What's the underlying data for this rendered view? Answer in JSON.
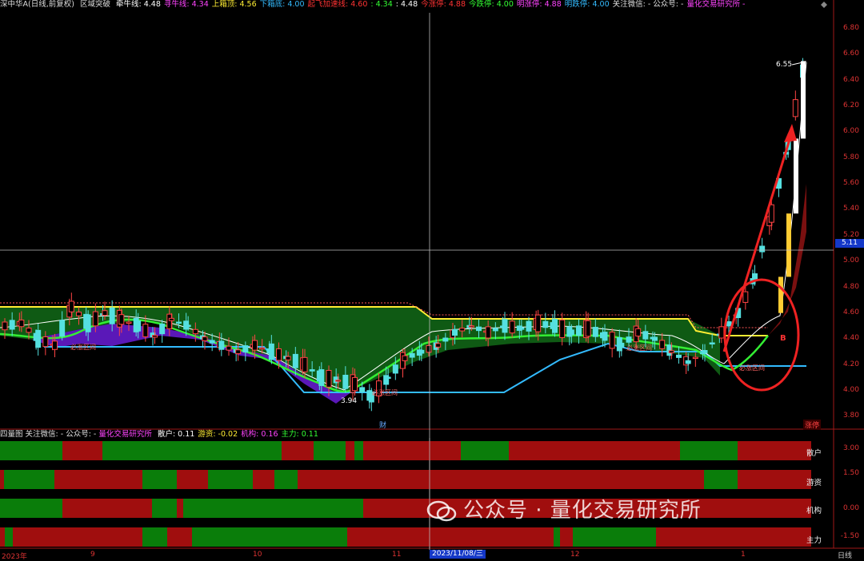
{
  "header": {
    "stock": "深中华A(日线,前复权)",
    "indicator": "区域突破",
    "items": [
      {
        "label": "牵牛线: 4.48",
        "color": "#ffffff"
      },
      {
        "label": "寻牛线: 4.34",
        "color": "#ff44ff"
      },
      {
        "label": "上箱顶: 4.56",
        "color": "#ffee33"
      },
      {
        "label": "下箱底: 4.00",
        "color": "#33bbff"
      },
      {
        "label": "起飞加速线: 4.60",
        "color": "#ff3333"
      },
      {
        "label": ": 4.34",
        "color": "#33ff33"
      },
      {
        "label": ": 4.48",
        "color": "#ffffff"
      },
      {
        "label": "今涨停: 4.88",
        "color": "#ff3333"
      },
      {
        "label": "今跌停: 4.00",
        "color": "#33ff33"
      },
      {
        "label": "明涨停: 4.88",
        "color": "#ff44ff"
      },
      {
        "label": "明跌停: 4.00",
        "color": "#33bbff"
      },
      {
        "label": "关注微信: - 公众号: -",
        "color": "#dddddd"
      },
      {
        "label": "量化交易研究所 -",
        "color": "#ff44ff"
      }
    ]
  },
  "price_axis": [
    "6.80",
    "6.60",
    "6.40",
    "6.20",
    "6.00",
    "5.80",
    "5.60",
    "5.40",
    "5.20",
    "5.00",
    "4.80",
    "4.60",
    "4.40",
    "4.20",
    "4.00",
    "3.80"
  ],
  "current_price": "5.11",
  "annotations": {
    "high": "6.55",
    "low": "3.94",
    "zhangting": "涨停",
    "cai": "财",
    "b": "B",
    "sell": "必涨区间"
  },
  "lower_panel": {
    "title": "四量图",
    "follow": "关注微信: - 公众号: -",
    "brand": "量化交易研究所",
    "values": [
      {
        "label": "散户: 0.11",
        "color": "#ffffff"
      },
      {
        "label": "游资: -0.02",
        "color": "#ffee33"
      },
      {
        "label": "机构: 0.16",
        "color": "#ff44ff"
      },
      {
        "label": "主力: 0.11",
        "color": "#33ff33"
      }
    ],
    "rows": [
      "散户",
      "游资",
      "机构",
      "主力"
    ],
    "axis": [
      "3.00",
      "1.50",
      "0.00",
      "-1.50"
    ]
  },
  "date_axis": {
    "labels": [
      "2023年",
      "9",
      "10",
      "11",
      "12",
      "1"
    ],
    "cursor_date": "2023/11/08/三",
    "period_tab": "日线"
  },
  "watermark": "公众号 · 量化交易研究所",
  "chart_data": {
    "type": "candlestick",
    "title": "深中华A(日线,前复权)",
    "ylim": [
      3.8,
      6.8
    ],
    "points": [
      {
        "i": 0,
        "o": 4.55,
        "c": 4.5
      },
      {
        "i": 5,
        "o": 4.5,
        "c": 4.52
      },
      {
        "i": 10,
        "o": 4.48,
        "c": 4.4
      },
      {
        "i": 15,
        "o": 4.4,
        "c": 4.35
      },
      {
        "i": 20,
        "o": 4.38,
        "c": 4.65
      },
      {
        "i": 25,
        "o": 4.6,
        "c": 4.52
      },
      {
        "i": 30,
        "o": 4.52,
        "c": 4.6
      },
      {
        "i": 35,
        "o": 4.6,
        "c": 4.55
      },
      {
        "i": 40,
        "o": 4.55,
        "c": 4.5
      },
      {
        "i": 45,
        "o": 4.5,
        "c": 4.42
      },
      {
        "i": 50,
        "o": 4.45,
        "c": 4.55
      },
      {
        "i": 55,
        "o": 4.55,
        "c": 4.5
      },
      {
        "i": 60,
        "o": 4.5,
        "c": 4.4
      },
      {
        "i": 65,
        "o": 4.4,
        "c": 4.35
      },
      {
        "i": 70,
        "o": 4.35,
        "c": 4.3
      },
      {
        "i": 75,
        "o": 4.3,
        "c": 4.35
      },
      {
        "i": 80,
        "o": 4.35,
        "c": 4.3
      },
      {
        "i": 85,
        "o": 4.3,
        "c": 4.25
      },
      {
        "i": 90,
        "o": 4.25,
        "c": 4.2
      },
      {
        "i": 95,
        "o": 4.2,
        "c": 4.1
      },
      {
        "i": 100,
        "o": 4.15,
        "c": 4.08
      },
      {
        "i": 105,
        "o": 4.1,
        "c": 4.05
      },
      {
        "i": 110,
        "o": 4.05,
        "c": 3.95
      },
      {
        "i": 115,
        "o": 3.95,
        "c": 4.1
      },
      {
        "i": 120,
        "o": 4.1,
        "c": 4.25
      },
      {
        "i": 125,
        "o": 4.25,
        "c": 4.3
      },
      {
        "i": 130,
        "o": 4.3,
        "c": 4.35
      },
      {
        "i": 135,
        "o": 4.35,
        "c": 4.45
      },
      {
        "i": 140,
        "o": 4.45,
        "c": 4.5
      },
      {
        "i": 145,
        "o": 4.5,
        "c": 4.45
      },
      {
        "i": 150,
        "o": 4.45,
        "c": 4.5
      },
      {
        "i": 155,
        "o": 4.5,
        "c": 4.48
      },
      {
        "i": 160,
        "o": 4.48,
        "c": 4.52
      },
      {
        "i": 165,
        "o": 4.52,
        "c": 4.5
      },
      {
        "i": 170,
        "o": 4.5,
        "c": 4.45
      },
      {
        "i": 175,
        "o": 4.45,
        "c": 4.48
      },
      {
        "i": 180,
        "o": 4.48,
        "c": 4.42
      },
      {
        "i": 185,
        "o": 4.42,
        "c": 4.35
      },
      {
        "i": 190,
        "o": 4.35,
        "c": 4.45
      },
      {
        "i": 195,
        "o": 4.45,
        "c": 4.4
      },
      {
        "i": 200,
        "o": 4.4,
        "c": 4.3
      },
      {
        "i": 205,
        "o": 4.3,
        "c": 4.22
      },
      {
        "i": 210,
        "o": 4.22,
        "c": 4.3
      },
      {
        "i": 215,
        "o": 4.3,
        "c": 4.45
      },
      {
        "i": 220,
        "o": 4.45,
        "c": 4.6
      },
      {
        "i": 225,
        "o": 4.6,
        "c": 4.88
      },
      {
        "i": 230,
        "o": 4.88,
        "c": 5.37
      },
      {
        "i": 235,
        "o": 5.37,
        "c": 5.9
      },
      {
        "i": 240,
        "o": 5.9,
        "c": 6.55
      }
    ]
  }
}
